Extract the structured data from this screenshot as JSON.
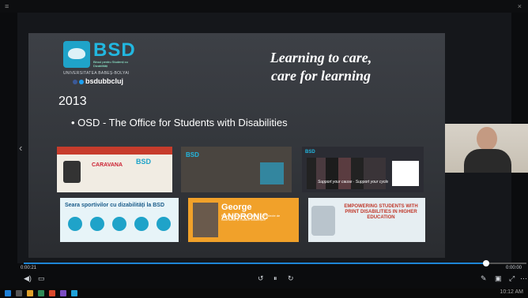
{
  "slide": {
    "brand": "BSD",
    "brand_sub": "Biroul pentru Studenți cu Dizabilități",
    "university": "UNIVERSITATEA BABEȘ-BOLYAI",
    "social_handle": "bsdubbcluj",
    "tagline_line1": "Learning to care,",
    "tagline_line2": "care for learning",
    "year": "2013",
    "bullet": "• OSD - The Office for Students with Disabilities"
  },
  "thumbnails": [
    {
      "label": "CARAVANA",
      "badge": "BSD"
    },
    {
      "label": "BSD"
    },
    {
      "label": "BSD",
      "motto": "Support your cause · Support your cycle"
    },
    {
      "label": "Seara sportivilor cu dizabilități la BSD"
    },
    {
      "label": "George ANDRONIC",
      "sub": "Prezintă studii despre BSD — Proiecte de voluntariat și Tabăra Studenților"
    },
    {
      "label": "EMPOWERING STUDENTS WITH PRINT DISABILITIES IN HIGHER EDUCATION"
    }
  ],
  "player": {
    "progress": 0.92,
    "time_left": "0:00:21",
    "time_right": "0:00:00"
  },
  "taskbar": {
    "clock": "10:12 AM"
  },
  "colors": {
    "accent": "#1fa3c9",
    "progress": "#1e86d6",
    "slide_bg": "#3a3d42"
  }
}
